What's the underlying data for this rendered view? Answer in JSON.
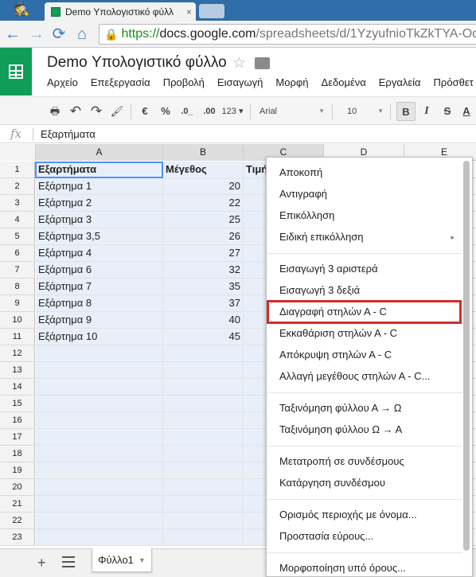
{
  "browser": {
    "tab_title": "Demo Υπολογιστικό φύλλ",
    "tab_close": "×",
    "url_https": "https://",
    "url_host": "docs.google.com",
    "url_path": "/spreadsheets/d/1YzyufnioTkZkTYA-Od"
  },
  "doc": {
    "title": "Demo Υπολογιστικό φύλλο",
    "menu": [
      "Αρχείο",
      "Επεξεργασία",
      "Προβολή",
      "Εισαγωγή",
      "Μορφή",
      "Δεδομένα",
      "Εργαλεία",
      "Πρόσθετ"
    ]
  },
  "toolbar": {
    "currency": "€",
    "percent": "%",
    "dec_decrease": ".0_",
    "dec_increase": ".00",
    "more_formats": "123 ▾",
    "font": "Arial",
    "font_size": "10",
    "bold": "B",
    "italic": "I",
    "strike": "S",
    "text_color": "A"
  },
  "formula_bar": {
    "fx": "fx",
    "value": "Εξαρτήματα"
  },
  "grid": {
    "columns": [
      "A",
      "B",
      "C",
      "D",
      "E"
    ],
    "row_numbers": [
      "1",
      "2",
      "3",
      "4",
      "5",
      "6",
      "7",
      "8",
      "9",
      "10",
      "11",
      "12",
      "13",
      "14",
      "15",
      "16",
      "17",
      "18",
      "19",
      "20",
      "21",
      "22",
      "23"
    ],
    "header": [
      "Εξαρτήματα",
      "Μέγεθος",
      "Τιμή"
    ],
    "rows": [
      [
        "Εξάρτημα 1",
        "20"
      ],
      [
        "Εξάρτημα 2",
        "22"
      ],
      [
        "Εξάρτημα 3",
        "25"
      ],
      [
        "Εξάρτημα 3,5",
        "26"
      ],
      [
        "Εξάρτημα 4",
        "27"
      ],
      [
        "Εξάρτημα 6",
        "32"
      ],
      [
        "Εξάρτημα 7",
        "35"
      ],
      [
        "Εξάρτημα 8",
        "37"
      ],
      [
        "Εξάρτημα 9",
        "40"
      ],
      [
        "Εξάρτημα 10",
        "45"
      ]
    ]
  },
  "sheets": {
    "active": "Φύλλο1"
  },
  "context_menu": {
    "groups": [
      [
        {
          "label": "Αποκοπή"
        },
        {
          "label": "Αντιγραφή"
        },
        {
          "label": "Επικόλληση"
        },
        {
          "label": "Ειδική επικόλληση",
          "submenu": "▸"
        }
      ],
      [
        {
          "label": "Εισαγωγή 3 αριστερά"
        },
        {
          "label": "Εισαγωγή 3 δεξιά"
        },
        {
          "label": "Διαγραφή στηλών Α - C",
          "highlighted": true
        },
        {
          "label": "Εκκαθάριση στηλών Α - C"
        },
        {
          "label": "Απόκρυψη στηλών Α - C"
        },
        {
          "label": "Αλλαγή μεγέθους στηλών Α - C..."
        }
      ],
      [
        {
          "label": "Ταξινόμηση φύλλου Α → Ω"
        },
        {
          "label": "Ταξινόμηση φύλλου Ω → Α"
        }
      ],
      [
        {
          "label": "Μετατροπή σε συνδέσμους"
        },
        {
          "label": "Κατάργηση συνδέσμου"
        }
      ],
      [
        {
          "label": "Ορισμός περιοχής με όνομα..."
        },
        {
          "label": "Προστασία εύρους..."
        }
      ],
      [
        {
          "label": "Μορφοποίηση υπό όρους..."
        }
      ]
    ]
  },
  "colors": {
    "highlight_border": "#d52b2b",
    "selection_fill": "#e8eff9",
    "sheets_green": "#0f9d58",
    "tab_bar": "#2f6ea8"
  }
}
